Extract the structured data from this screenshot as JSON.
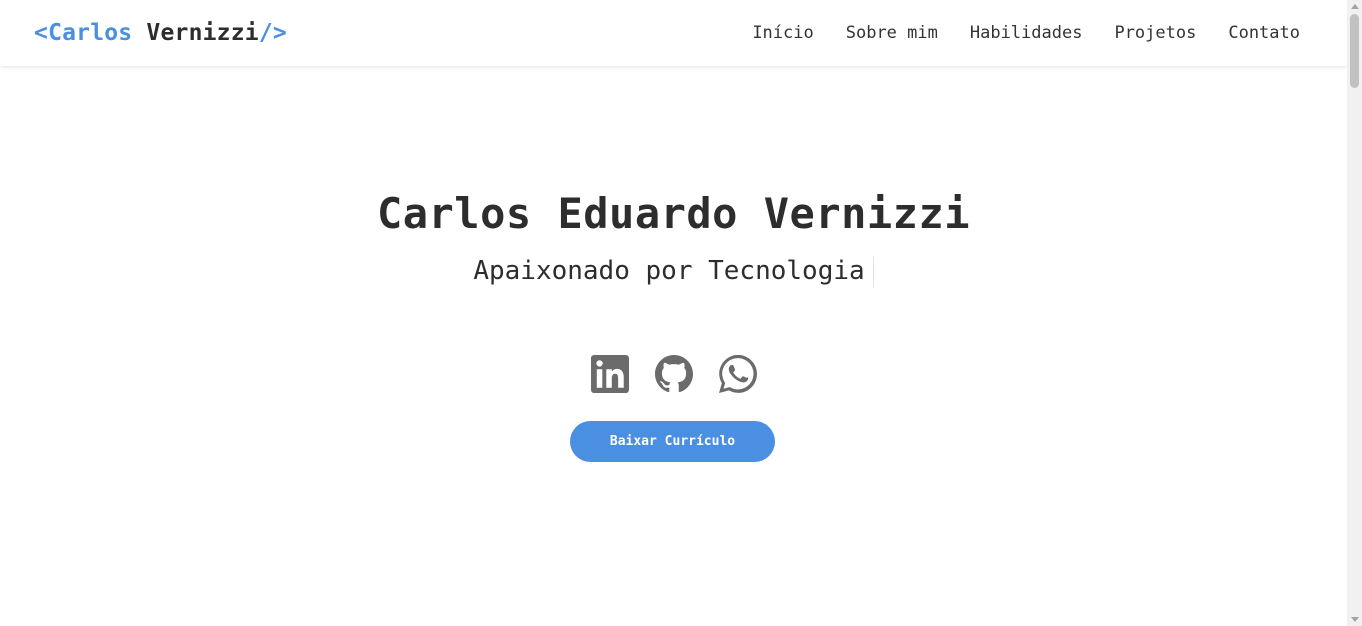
{
  "navbar": {
    "logo": {
      "open": "<",
      "first": "Carlos",
      "second": "Vernizzi",
      "close": "/>"
    },
    "links": [
      "Início",
      "Sobre mim",
      "Habilidades",
      "Projetos",
      "Contato"
    ]
  },
  "hero": {
    "name": "Carlos Eduardo Vernizzi",
    "subtitle": "Apaixonado por Tecnologia",
    "socials": [
      "linkedin-icon",
      "github-icon",
      "whatsapp-icon"
    ],
    "cv_button_label": "Baixar Currículo"
  },
  "colors": {
    "accent": "#4a8fe2",
    "text": "#2d2d2d",
    "icon": "#6b6b6b"
  }
}
